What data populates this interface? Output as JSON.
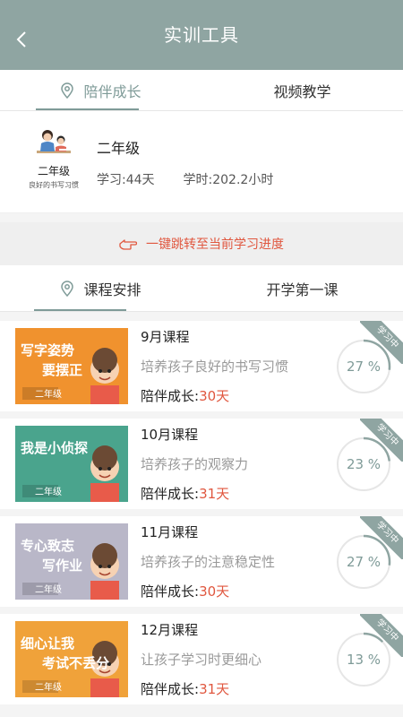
{
  "header": {
    "title": "实训工具"
  },
  "tabs": [
    {
      "label": "陪伴成长",
      "active": true
    },
    {
      "label": "视频教学",
      "active": false
    }
  ],
  "profile": {
    "avatar_grade": "二年级",
    "avatar_sub": "良好的书写习惯",
    "grade": "二年级",
    "study_days": "学习:44天",
    "study_hours": "学时:202.2小时"
  },
  "jump": {
    "label": "一键跳转至当前学习进度"
  },
  "subtabs": [
    {
      "label": "课程安排",
      "active": true
    },
    {
      "label": "开学第一课",
      "active": false
    }
  ],
  "courses": [
    {
      "name": "9月课程",
      "desc": "培养孩子良好的书写习惯",
      "companion_label": "陪伴成长:",
      "days": "30天",
      "percent": "27 %",
      "progress": 0.27,
      "ribbon": "学习中",
      "thumb": {
        "bg": "#f0922e",
        "line1": "写字姿势",
        "line2": "要摆正",
        "grade": "二年级"
      }
    },
    {
      "name": "10月课程",
      "desc": "培养孩子的观察力",
      "companion_label": "陪伴成长:",
      "days": "31天",
      "percent": "23 %",
      "progress": 0.23,
      "ribbon": "学习中",
      "thumb": {
        "bg": "#4aa48d",
        "line1": "我是小侦探",
        "line2": "",
        "grade": "二年级"
      }
    },
    {
      "name": "11月课程",
      "desc": "培养孩子的注意稳定性",
      "companion_label": "陪伴成长:",
      "days": "30天",
      "percent": "27 %",
      "progress": 0.27,
      "ribbon": "学习中",
      "thumb": {
        "bg": "#b9b7c8",
        "line1": "专心致志",
        "line2": "写作业",
        "grade": "二年级"
      }
    },
    {
      "name": "12月课程",
      "desc": "让孩子学习时更细心",
      "companion_label": "陪伴成长:",
      "days": "31天",
      "percent": "13 %",
      "progress": 0.13,
      "ribbon": "学习中",
      "thumb": {
        "bg": "#f0a23a",
        "line1": "细心让我",
        "line2": "考试不丢分",
        "grade": "二年级"
      }
    }
  ]
}
